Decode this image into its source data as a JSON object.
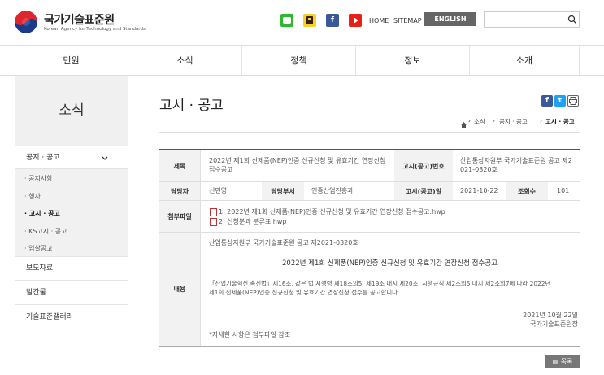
{
  "header": {
    "logo_name": "국가기술표준원",
    "logo_sub": "Korean Agency for Technology and Standards",
    "links": {
      "home": "HOME",
      "sitemap": "SITEMAP",
      "english": "ENGLISH"
    },
    "search": {
      "placeholder": ""
    },
    "sns": [
      "line-icon",
      "kakao-icon",
      "facebook-icon",
      "youtube-icon"
    ]
  },
  "gnb": [
    "민원",
    "소식",
    "정책",
    "정보",
    "소개"
  ],
  "lnb": {
    "title": "소식",
    "items": [
      {
        "label": "공지 · 공고",
        "open": true
      },
      {
        "label": "보도자료"
      },
      {
        "label": "발간물"
      },
      {
        "label": "기술표준갤러리"
      }
    ],
    "sub_items": [
      "· 공지사항",
      "· 행사",
      "· 고시 · 공고",
      "· KS고시 · 공고",
      "· 입찰공고"
    ],
    "active_sub": 2
  },
  "content": {
    "title": "고시 · 공고",
    "breadcrumb": [
      "소식",
      "공지 · 공고",
      "고시 · 공고"
    ],
    "post": {
      "label_title": "제목",
      "title_line1": "2022년 제1회 신제품(NEP)인증 신규신청 및 유효기간 연장신청",
      "title_line2": "접수공고",
      "label_notice_no": "고시(공고)번호",
      "notice_no_line1": "산업통상자원부 국가기술표준원 공고 제2",
      "notice_no_line2": "021-0320호",
      "label_manager": "담당자",
      "manager": "신민영",
      "label_dept": "담당부서",
      "dept": "인증산업진흥과",
      "label_date": "고시(공고)일",
      "date": "2021-10-22",
      "label_views": "조회수",
      "views": "101",
      "label_attach": "첨부파일",
      "attachments": [
        "1. 2022년 제1회 신제품(NEP)인증 신규신청 및 유효기간 연장신청 접수공고.hwp",
        "2. 신청분과 분류표.hwp"
      ],
      "label_body": "내용",
      "body_line1": "산업통상자원부 국가기술표준원 공고 제2021-0320호",
      "body_heading": "2022년 제1회 신제품(NEP)인증 신규신청 및 유효기간 연장신청 접수공고",
      "body_para1": "「산업기술혁신 촉진법」제16조, 같은 법 시행령 제18조의5, 제19조 내지 제20조, 시행규칙 제2조의5 내지 제2조의7에 따라 2022년",
      "body_para2": "제1회 신제품(NEP)인증 신규신청 및 유효기간 연장신청 접수를 공고합니다.",
      "sign_date": "2021년 10월 22일",
      "sign_org": "국가기술표준원장",
      "body_note": "*자세한 사항은 첨부파일 참조"
    },
    "list_button": "목록"
  },
  "colors": {
    "facebook": "#3b5998",
    "twitter": "#1da1f2",
    "youtube": "#e62117",
    "line": "#2eb82e",
    "kakao": "#f5d22a",
    "header_btn": "#666666"
  }
}
